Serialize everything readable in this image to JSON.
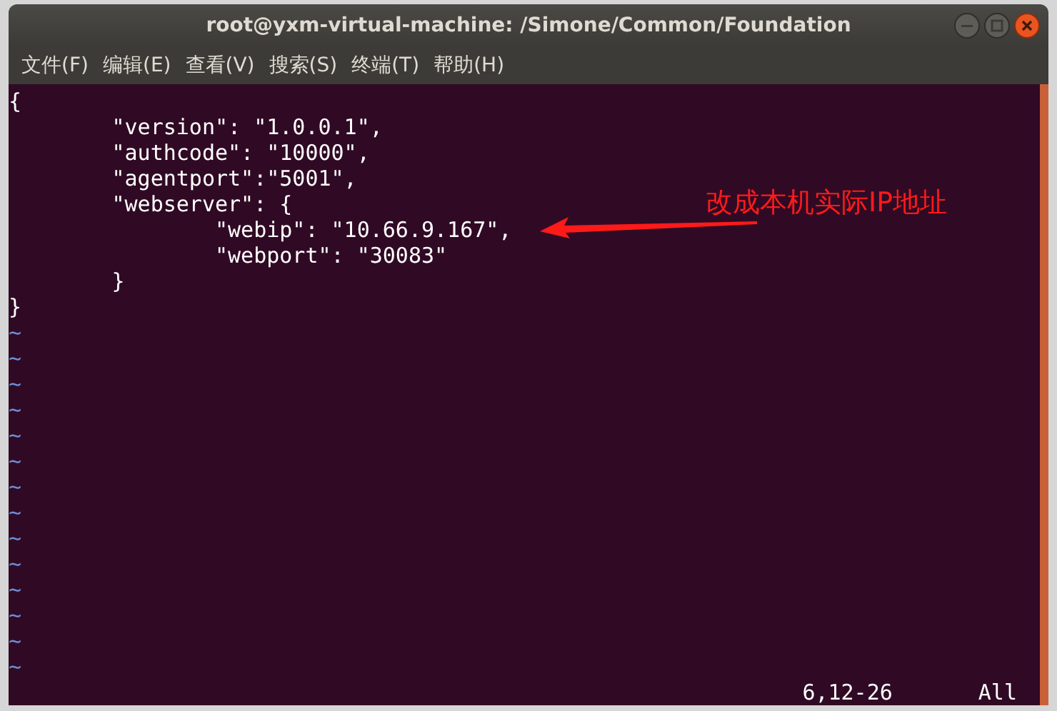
{
  "window": {
    "title": "root@yxm-virtual-machine: /Simone/Common/Foundation"
  },
  "menu": [
    "文件(F)",
    "编辑(E)",
    "查看(V)",
    "搜索(S)",
    "终端(T)",
    "帮助(H)"
  ],
  "editor": {
    "lines": [
      "{",
      "\t\"version\": \"1.0.0.1\",",
      "\t\"authcode\": \"10000\",",
      "\t\"agentport\":\"5001\",",
      "\t\"webserver\": {",
      "\t\t\"webip\": \"10.66.9.167\",",
      "\t\t\"webport\": \"30083\"",
      "\t}",
      "}"
    ],
    "empty_lines": [
      "~",
      "~",
      "~",
      "~",
      "~",
      "~",
      "~",
      "~",
      "~",
      "~",
      "~",
      "~",
      "~",
      "~"
    ],
    "status": {
      "position": "6,12-26",
      "scroll": "All"
    }
  },
  "annotation": {
    "text": "改成本机实际IP地址"
  }
}
